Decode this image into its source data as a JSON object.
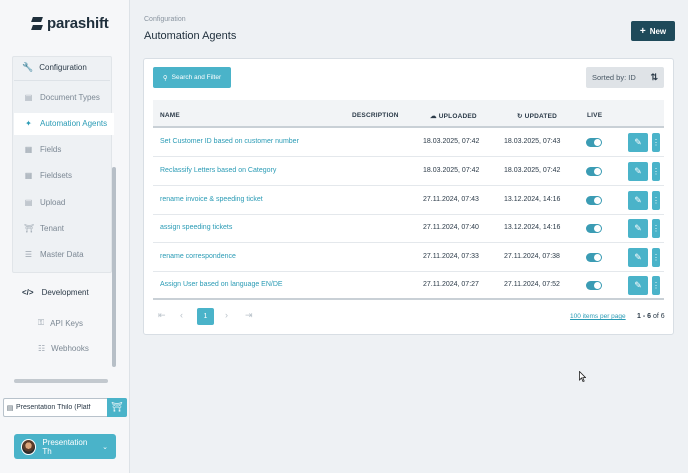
{
  "brand": {
    "name": "parashift"
  },
  "sidebar": {
    "config_label": "Configuration",
    "items": [
      {
        "label": "Document Types",
        "icon": "document-icon"
      },
      {
        "label": "Automation Agents",
        "icon": "sparkle-agent-icon"
      },
      {
        "label": "Fields",
        "icon": "table-icon"
      },
      {
        "label": "Fieldsets",
        "icon": "table-icon"
      },
      {
        "label": "Upload",
        "icon": "upload-file-icon"
      },
      {
        "label": "Tenant",
        "icon": "bank-icon"
      },
      {
        "label": "Master Data",
        "icon": "database-icon"
      }
    ],
    "dev_label": "Development",
    "dev_items": [
      {
        "label": "API Keys",
        "icon": "key-icon"
      },
      {
        "label": "Webhooks",
        "icon": "network-icon"
      }
    ],
    "tenant_text": "Presentation Thilo (Platf",
    "user_label": "Presentation Th"
  },
  "header": {
    "breadcrumb": "Configuration",
    "title": "Automation Agents",
    "new_label": "New"
  },
  "toolbar": {
    "search_label": "Search and Filter",
    "sort_label": "Sorted by: ID"
  },
  "table": {
    "columns": {
      "name": "NAME",
      "description": "DESCRIPTION",
      "uploaded": "UPLOADED",
      "updated": "UPDATED",
      "live": "LIVE"
    },
    "rows": [
      {
        "name": "Set Customer ID based on customer number",
        "uploaded": "18.03.2025, 07:42",
        "updated": "18.03.2025, 07:43",
        "live": true
      },
      {
        "name": "Reclassify Letters based on Category",
        "uploaded": "18.03.2025, 07:42",
        "updated": "18.03.2025, 07:42",
        "live": true
      },
      {
        "name": "rename invoice & speeding ticket",
        "uploaded": "27.11.2024, 07:43",
        "updated": "13.12.2024, 14:16",
        "live": true
      },
      {
        "name": "assign speeding tickets",
        "uploaded": "27.11.2024, 07:40",
        "updated": "13.12.2024, 14:16",
        "live": true
      },
      {
        "name": "rename correspondence",
        "uploaded": "27.11.2024, 07:33",
        "updated": "27.11.2024, 07:38",
        "live": true
      },
      {
        "name": "Assign User based on language EN/DE",
        "uploaded": "27.11.2024, 07:27",
        "updated": "27.11.2024, 07:52",
        "live": true
      }
    ]
  },
  "pagination": {
    "current_page": "1",
    "per_page_label": "100 items per page",
    "range_bold": "1 - 6",
    "range_rest": " of 6"
  },
  "colors": {
    "accent": "#4ab3c9",
    "primary_dark": "#1f4a5a",
    "link": "#2a9bb5"
  }
}
